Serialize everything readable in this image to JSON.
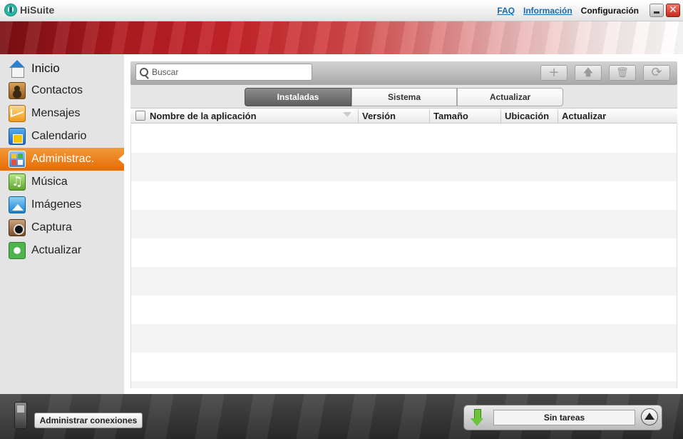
{
  "app": {
    "title": "HiSuite",
    "links": {
      "faq": "FAQ",
      "info": "Información",
      "settings": "Configuración"
    },
    "close_glyph": "✕"
  },
  "sidebar": {
    "items": [
      {
        "label": "Inicio",
        "icon": "home-icon",
        "active": false
      },
      {
        "label": "Contactos",
        "icon": "contacts-icon",
        "active": false
      },
      {
        "label": "Mensajes",
        "icon": "messages-icon",
        "active": false
      },
      {
        "label": "Calendario",
        "icon": "calendar-icon",
        "active": false
      },
      {
        "label": "Administrac.",
        "icon": "apps-manager-icon",
        "active": true
      },
      {
        "label": "Música",
        "icon": "music-icon",
        "active": false
      },
      {
        "label": "Imágenes",
        "icon": "images-icon",
        "active": false
      },
      {
        "label": "Captura",
        "icon": "capture-icon",
        "active": false
      },
      {
        "label": "Actualizar",
        "icon": "update-icon",
        "active": false
      }
    ]
  },
  "toolbar": {
    "search_placeholder": "Buscar",
    "buttons": [
      {
        "name": "add",
        "icon": "plus-icon",
        "glyph": "+"
      },
      {
        "name": "export",
        "icon": "upload-arrow-icon",
        "glyph": "🡅"
      },
      {
        "name": "delete",
        "icon": "trash-icon",
        "glyph": "🗑"
      },
      {
        "name": "refresh",
        "icon": "refresh-icon",
        "glyph": "⟳"
      }
    ]
  },
  "tabs": [
    {
      "label": "Instaladas",
      "active": true
    },
    {
      "label": "Sistema",
      "active": false
    },
    {
      "label": "Actualizar",
      "active": false
    }
  ],
  "table": {
    "columns": [
      "Nombre de la aplicación",
      "Versión",
      "Tamaño",
      "Ubicación",
      "Actualizar"
    ],
    "rows": []
  },
  "footer": {
    "connections_button": "Administrar conexiones",
    "task_status": "Sin tareas"
  },
  "colors": {
    "accent_active": "#e56b06",
    "banner_red": "#b21a20",
    "link_blue": "#1a6bb0"
  }
}
